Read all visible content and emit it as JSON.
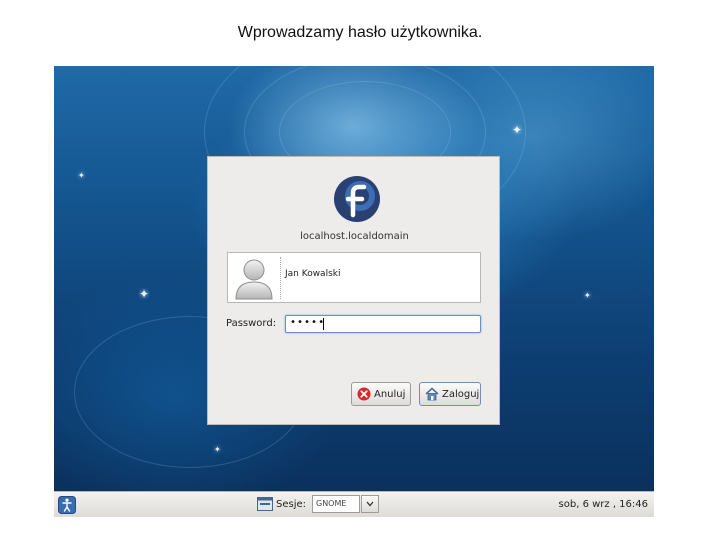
{
  "caption": "Wprowadzamy hasło użytkownika.",
  "login": {
    "host": "localhost.localdomain",
    "logo_icon": "fedora-logo-icon",
    "users": [
      {
        "name": "Jan Kowalski",
        "icon": "user-avatar-icon"
      }
    ],
    "password_label": "Password:",
    "password_value": "•••••",
    "buttons": {
      "cancel_label": "Anuluj",
      "cancel_icon": "cancel-icon",
      "login_label": "Zaloguj",
      "login_icon": "home-icon"
    }
  },
  "taskbar": {
    "accessibility_icon": "accessibility-icon",
    "session_icon": "session-icon",
    "session_label": "Sesje:",
    "session_value": "GNOME",
    "dropdown_icon": "chevron-down-icon",
    "clock": "sob, 6 wrz , 16:46"
  },
  "colors": {
    "background_top": "#1f6aa8",
    "background_bottom": "#0a2e59",
    "dialog": "#edeceb",
    "logo_blue": "#294172"
  }
}
